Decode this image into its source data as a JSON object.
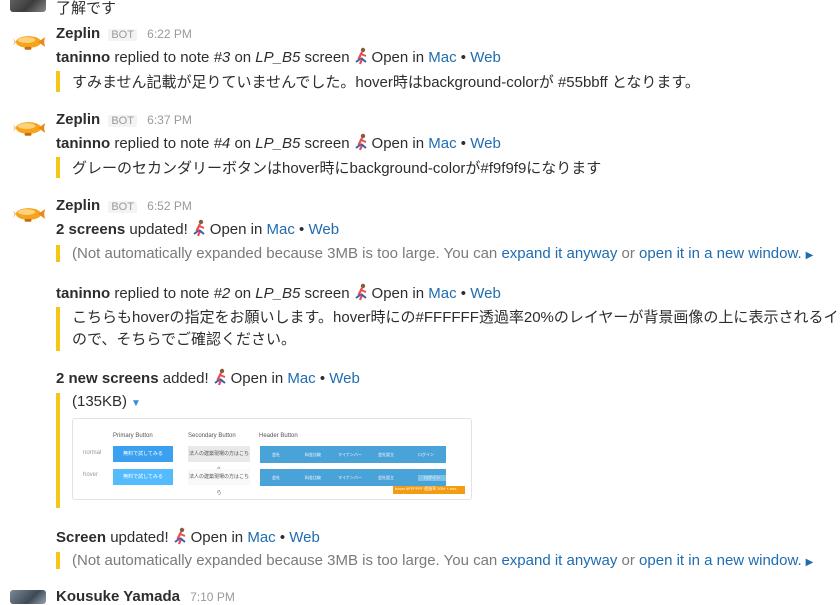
{
  "prev": {
    "text": "了解です"
  },
  "messages": [
    {
      "author": "Zeplin",
      "bot": "BOT",
      "time": "6:22 PM",
      "user": "taninno",
      "note": "#3",
      "screen": "LP_B5",
      "quote": "すみません記載が足りていませんでした。hover時はbackground-colorが #55bbff となります。"
    },
    {
      "author": "Zeplin",
      "bot": "BOT",
      "time": "6:37 PM",
      "user": "taninno",
      "note": "#4",
      "screen": "LP_B5",
      "quote": "グレーのセカンダリーボタンはhover時にbackground-colorが#f9f9f9になります"
    },
    {
      "author": "Zeplin",
      "bot": "BOT",
      "time": "6:52 PM",
      "screens_updated": "2 screens",
      "screens_updated_suffix": "updated!",
      "notice": "(Not automatically expanded because 3MB is too large. You can",
      "expand": "expand it anyway",
      "or": "or",
      "open_new": "open it in a new window.",
      "user2": "taninno",
      "note2": "#2",
      "screen2": "LP_B5",
      "quote2_line1": "こちらもhoverの指定をお願いします。hover時にの#FFFFFF透過率20%のレイヤーが背景画像の上に表示されるイ",
      "quote2_line2": "ので、そちらでご確認ください。",
      "new_screens": "2 new screens",
      "new_screens_suffix": "added!",
      "file_size": "(135KB)",
      "screen_updated": "Screen",
      "screen_updated_suffix": "updated!"
    }
  ],
  "common": {
    "replied": "replied to note",
    "on": "on",
    "screen_word": "screen",
    "open_in": "Open in",
    "mac": "Mac",
    "bullet": "•",
    "web": "Web"
  },
  "thumbnail": {
    "col_primary": "Primary Button",
    "col_secondary": "Secondary Button",
    "col_header": "Header Button",
    "row_normal": "normal",
    "row_hover": "hover",
    "primary_label": "無料で試してみる",
    "secondary_label": "法人の建築現場の方はこちら",
    "header_cells": [
      "会社",
      "料金比較",
      "マイナンバー",
      "会社設立",
      "ログイン"
    ],
    "tip": "hover #FFFFFF 透過率 20% + box-shadow"
  },
  "next_msg": {
    "author": "Kousuke Yamada",
    "time": "7:10 PM"
  },
  "colors": {
    "link": "#1f6cb0",
    "quote_bar": "#f5c518",
    "accent": "#2d8fd9"
  }
}
